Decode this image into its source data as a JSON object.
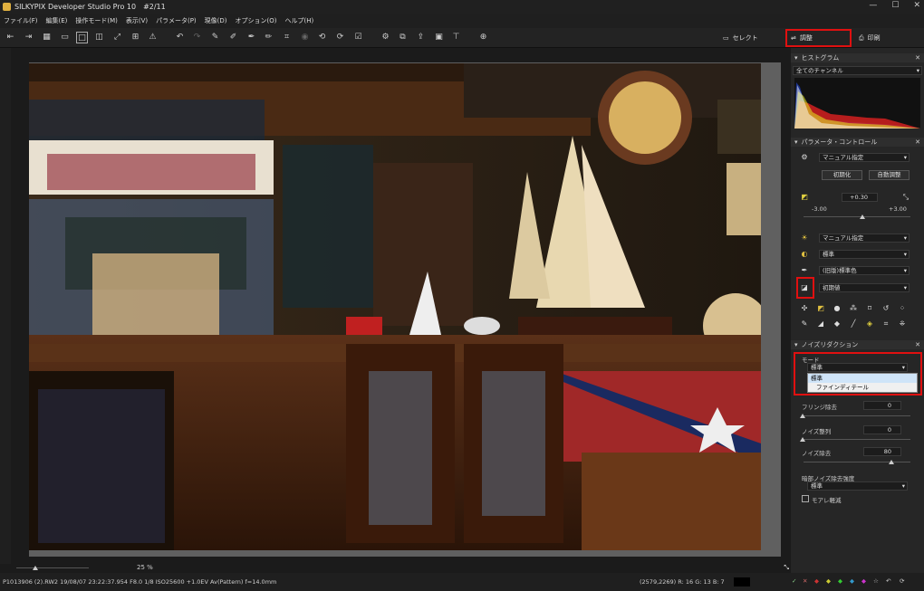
{
  "window": {
    "title": "SILKYPIX Developer Studio Pro 10　#2/11",
    "min": "—",
    "max": "☐",
    "close": "✕"
  },
  "menu": [
    "ファイル(F)",
    "編集(E)",
    "操作モード(M)",
    "表示(V)",
    "パラメータ(P)",
    "現像(D)",
    "オプション(O)",
    "ヘルプ(H)"
  ],
  "tabs": {
    "select": "セレクト",
    "adjust": "調整",
    "print": "印刷"
  },
  "histogram": {
    "title": "ヒストグラム",
    "channel": "全てのチャンネル"
  },
  "param_control": {
    "title": "パラメータ・コントロール",
    "preset": "マニュアル指定",
    "reset": "初期化",
    "auto": "自動調整",
    "exposure": {
      "value": "+0.30",
      "min": "-3.00",
      "max": "+3.00"
    },
    "wb": "マニュアル指定",
    "tone": "標準",
    "color": "(旧版)標準色",
    "sharp": "初期値"
  },
  "noise": {
    "title": "ノイズリダクション",
    "mode_label": "モード",
    "mode_value": "標準",
    "options": [
      "標準",
      "ファインディテール"
    ],
    "fringe_label": "フリンジ除去",
    "fringe_value": "0",
    "noise_label": "ノイズ整列",
    "noise_value": "0",
    "nr_label": "ノイズ除去",
    "nr_value": "80",
    "dark_label": "暗部ノイズ除去強度",
    "dark_value": "標準",
    "moire_label": "モアレ軽減"
  },
  "zoom": "25 %",
  "status": {
    "info": "P1013906 (2).RW2 19/08/07 23:22:37.954 F8.0 1/8 ISO25600 +1.0EV Av(Pattern) f=14.0mm",
    "coords": "(2579,2269) R: 16 G: 13 B:  7"
  }
}
